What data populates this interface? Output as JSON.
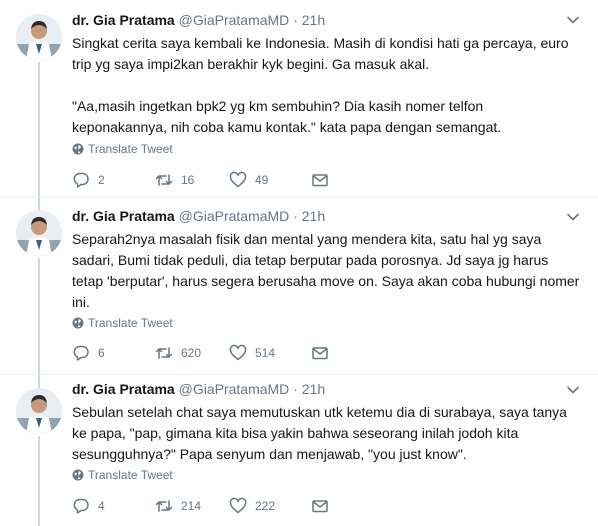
{
  "tweets": [
    {
      "name": "dr. Gia Pratama",
      "handle": "@GiaPratamaMD",
      "separator": "·",
      "time": "21h",
      "text": "Singkat cerita saya kembali ke Indonesia. Masih di kondisi hati ga percaya, euro trip yg saya impi2kan berakhir kyk begini. Ga masuk akal.\n\n\"Aa,masih ingetkan bpk2 yg km sembuhin? Dia kasih nomer telfon keponakannya, nih coba kamu kontak.\" kata papa dengan semangat.",
      "translate_label": "Translate Tweet",
      "replies": "2",
      "retweets": "16",
      "likes": "49"
    },
    {
      "name": "dr. Gia Pratama",
      "handle": "@GiaPratamaMD",
      "separator": "·",
      "time": "21h",
      "text": "Separah2nya masalah fisik dan mental yang mendera kita, satu hal yg saya sadari, Bumi tidak peduli, dia tetap berputar pada porosnya. Jd saya jg harus tetap 'berputar', harus segera berusaha move on. Saya akan coba hubungi nomer ini.",
      "translate_label": "Translate Tweet",
      "replies": "6",
      "retweets": "620",
      "likes": "514"
    },
    {
      "name": "dr. Gia Pratama",
      "handle": "@GiaPratamaMD",
      "separator": "·",
      "time": "21h",
      "text": "Sebulan setelah chat saya memutuskan utk ketemu dia di surabaya, saya tanya ke papa, \"pap, gimana kita bisa yakin bahwa seseorang inilah jodoh kita sesungguhnya?\" Papa senyum dan menjawab, \"you just know\".",
      "translate_label": "Translate Tweet",
      "replies": "4",
      "retweets": "214",
      "likes": "222"
    }
  ],
  "colors": {
    "text_primary": "#14171a",
    "text_secondary": "#657786",
    "thread_line": "#ccd6dd",
    "divider": "#e6ecf0"
  }
}
